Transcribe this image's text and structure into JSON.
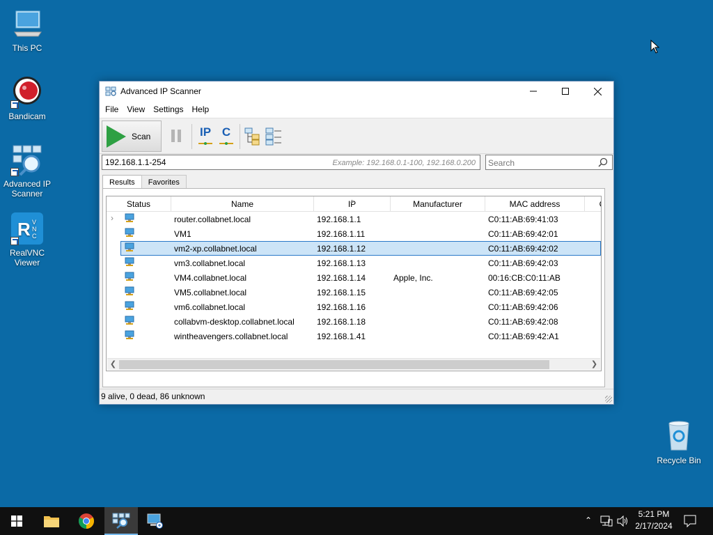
{
  "desktop": {
    "icons": [
      {
        "label": "This PC"
      },
      {
        "label": "Bandicam"
      },
      {
        "label": "Advanced IP Scanner"
      },
      {
        "label": "RealVNC Viewer"
      },
      {
        "label": "Recycle Bin"
      }
    ]
  },
  "window": {
    "title": "Advanced IP Scanner",
    "menu": [
      "File",
      "View",
      "Settings",
      "Help"
    ],
    "toolbar": {
      "scan_label": "Scan",
      "ip_label": "IP",
      "c_label": "C"
    },
    "address": {
      "value": "192.168.1.1-254",
      "example": "Example: 192.168.0.1-100, 192.168.0.200"
    },
    "search": {
      "placeholder": "Search"
    },
    "tabs": [
      {
        "label": "Results",
        "active": true
      },
      {
        "label": "Favorites",
        "active": false
      }
    ],
    "columns": [
      "Status",
      "Name",
      "IP",
      "Manufacturer",
      "MAC address",
      "C"
    ],
    "rows": [
      {
        "name": "router.collabnet.local",
        "ip": "192.168.1.1",
        "manufacturer": "",
        "mac": "C0:11:AB:69:41:03"
      },
      {
        "name": "VM1",
        "ip": "192.168.1.11",
        "manufacturer": "",
        "mac": "C0:11:AB:69:42:01"
      },
      {
        "name": "vm2-xp.collabnet.local",
        "ip": "192.168.1.12",
        "manufacturer": "",
        "mac": "C0:11:AB:69:42:02"
      },
      {
        "name": "vm3.collabnet.local",
        "ip": "192.168.1.13",
        "manufacturer": "",
        "mac": "C0:11:AB:69:42:03"
      },
      {
        "name": "VM4.collabnet.local",
        "ip": "192.168.1.14",
        "manufacturer": "Apple, Inc.",
        "mac": "00:16:CB:C0:11:AB"
      },
      {
        "name": "VM5.collabnet.local",
        "ip": "192.168.1.15",
        "manufacturer": "",
        "mac": "C0:11:AB:69:42:05"
      },
      {
        "name": "vm6.collabnet.local",
        "ip": "192.168.1.16",
        "manufacturer": "",
        "mac": "C0:11:AB:69:42:06"
      },
      {
        "name": "collabvm-desktop.collabnet.local",
        "ip": "192.168.1.18",
        "manufacturer": "",
        "mac": "C0:11:AB:69:42:08"
      },
      {
        "name": "wintheavengers.collabnet.local",
        "ip": "192.168.1.41",
        "manufacturer": "",
        "mac": "C0:11:AB:69:42:A1"
      }
    ],
    "selected_row": 2,
    "status": "9 alive, 0 dead, 86 unknown"
  },
  "taskbar": {
    "time": "5:21 PM",
    "date": "2/17/2024"
  },
  "colors": {
    "desktop": "#0b6aa6",
    "selection": "#cce4f7",
    "selection_border": "#2878c8",
    "scan_green": "#2ea043"
  }
}
